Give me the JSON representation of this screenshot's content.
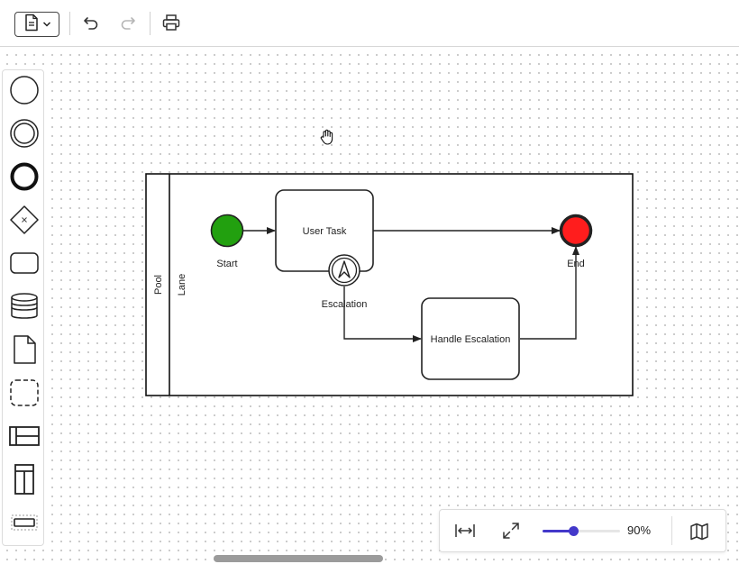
{
  "toolbar": {
    "file_menu_icon": "document-icon",
    "undo_icon": "undo-icon",
    "redo_icon": "redo-icon",
    "print_icon": "printer-icon"
  },
  "palette": {
    "items": [
      {
        "icon": "start-event-icon"
      },
      {
        "icon": "intermediate-event-icon"
      },
      {
        "icon": "end-event-icon"
      },
      {
        "icon": "gateway-icon"
      },
      {
        "icon": "task-icon"
      },
      {
        "icon": "data-store-icon"
      },
      {
        "icon": "data-object-icon"
      },
      {
        "icon": "group-icon"
      },
      {
        "icon": "pool-horizontal-icon"
      },
      {
        "icon": "pool-vertical-icon"
      },
      {
        "icon": "lane-icon"
      }
    ]
  },
  "diagram": {
    "pool_label": "Pool",
    "lane_label": "Lane",
    "start_label": "Start",
    "user_task_label": "User Task",
    "escalation_label": "Escalation",
    "handle_escalation_label": "Handle Escalation",
    "end_label": "End",
    "colors": {
      "start_fill": "#22a00f",
      "end_fill": "#ff1d1d",
      "stroke": "#222222"
    }
  },
  "zoom": {
    "fit_width_icon": "fit-width-icon",
    "fullscreen_icon": "expand-icon",
    "value": 0.4,
    "label": "90%",
    "minimap_icon": "map-icon",
    "accent": "#4338ca"
  }
}
